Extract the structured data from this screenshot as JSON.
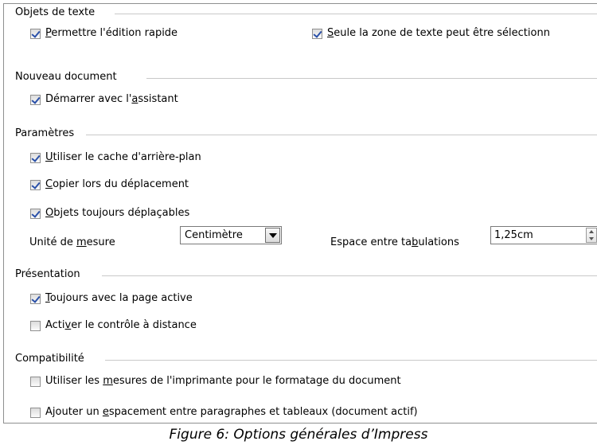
{
  "sections": {
    "text_objects": {
      "heading": "Objets de texte",
      "quick_edit": {
        "prefix": "",
        "accel": "P",
        "rest": "ermettre l'édition rapide",
        "checked": true
      },
      "select_text_area": {
        "prefix": "",
        "accel": "S",
        "rest": "eule la zone de texte peut être sélectionn",
        "checked": true
      }
    },
    "new_document": {
      "heading": "Nouveau document",
      "start_wizard": {
        "prefix": "Démarrer avec l'",
        "accel": "a",
        "rest": "ssistant",
        "checked": true
      }
    },
    "settings": {
      "heading": "Paramètres",
      "background_cache": {
        "prefix": "",
        "accel": "U",
        "rest": "tiliser le cache d'arrière-plan",
        "checked": true
      },
      "copy_while_moving": {
        "prefix": "",
        "accel": "C",
        "rest": "opier lors du déplacement",
        "checked": true
      },
      "objects_movable": {
        "prefix": "",
        "accel": "O",
        "rest": "bjets toujours déplaçables",
        "checked": true
      },
      "unit_label": {
        "prefix": "Unité de ",
        "accel": "m",
        "rest": "esure"
      },
      "unit_value": "Centimètre",
      "tab_label": {
        "prefix": "Espace entre ta",
        "accel": "b",
        "rest": "ulations"
      },
      "tab_value": "1,25cm"
    },
    "presentation": {
      "heading": "Présentation",
      "always_active_page": {
        "prefix": "",
        "accel": "T",
        "rest": "oujours avec la page active",
        "checked": true
      },
      "remote_control": {
        "prefix": "Acti",
        "accel": "v",
        "rest": "er le contrôle à distance",
        "checked": false
      }
    },
    "compatibility": {
      "heading": "Compatibilité",
      "printer_metrics": {
        "prefix": "Utiliser les ",
        "accel": "m",
        "rest": "esures de l'imprimante pour le formatage du document",
        "checked": false
      },
      "add_spacing": {
        "prefix": "Ajouter un ",
        "accel": "e",
        "rest": "spacement entre paragraphes et tableaux (document actif)",
        "checked": false
      }
    }
  },
  "caption": "Figure 6: Options générales d’Impress"
}
